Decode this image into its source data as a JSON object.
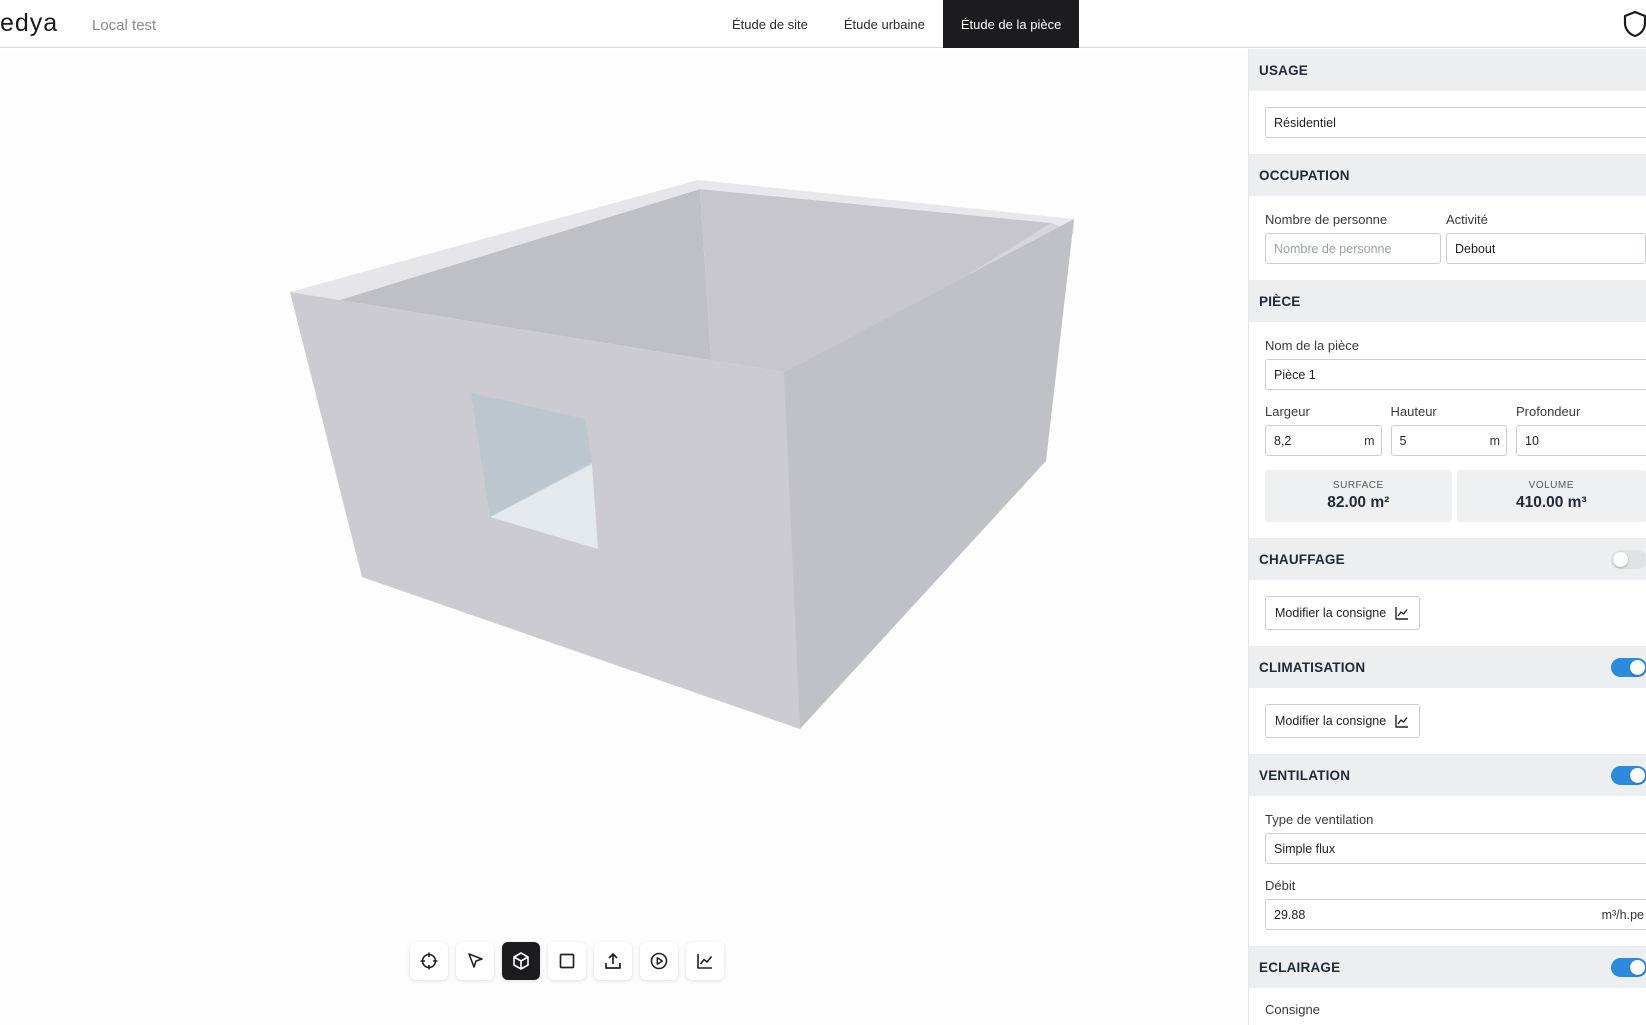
{
  "app": {
    "logo": "edya",
    "project": "Local test"
  },
  "tabs": [
    {
      "label": "Étude de site"
    },
    {
      "label": "Étude urbaine"
    },
    {
      "label": "Étude de la pièce"
    }
  ],
  "panel": {
    "usage": {
      "title": "USAGE",
      "value": "Résidentiel"
    },
    "occupation": {
      "title": "OCCUPATION",
      "persons_label": "Nombre de personne",
      "persons_placeholder": "Nombre de personne",
      "activity_label": "Activité",
      "activity_value": "Debout"
    },
    "piece": {
      "title": "PIÈCE",
      "name_label": "Nom de la pièce",
      "name_value": "Pièce 1",
      "largeur_label": "Largeur",
      "largeur_value": "8,2",
      "largeur_unit": "m",
      "hauteur_label": "Hauteur",
      "hauteur_value": "5",
      "hauteur_unit": "m",
      "profondeur_label": "Profondeur",
      "profondeur_value": "10",
      "surface_label": "SURFACE",
      "surface_value": "82.00 m²",
      "volume_label": "VOLUME",
      "volume_value": "410.00 m³"
    },
    "chauffage": {
      "title": "CHAUFFAGE",
      "enabled": false,
      "button": "Modifier la consigne"
    },
    "climatisation": {
      "title": "CLIMATISATION",
      "enabled": true,
      "button": "Modifier la consigne"
    },
    "ventilation": {
      "title": "VENTILATION",
      "enabled": true,
      "type_label": "Type de ventilation",
      "type_value": "Simple flux",
      "debit_label": "Débit",
      "debit_value": "29.88",
      "debit_unit": "m³/h.pe"
    },
    "eclairage": {
      "title": "ECLAIRAGE",
      "enabled": true,
      "consigne_label": "Consigne"
    }
  },
  "toolbar": {
    "active": "cube-icon",
    "tools": [
      "target-icon",
      "cursor-icon",
      "cube-icon",
      "square-icon",
      "upload-icon",
      "play-icon",
      "chart-icon"
    ]
  },
  "colors": {
    "accent": "#2d8bde",
    "active_tab": "#1c1c1e",
    "section_bg": "#eceef0"
  }
}
